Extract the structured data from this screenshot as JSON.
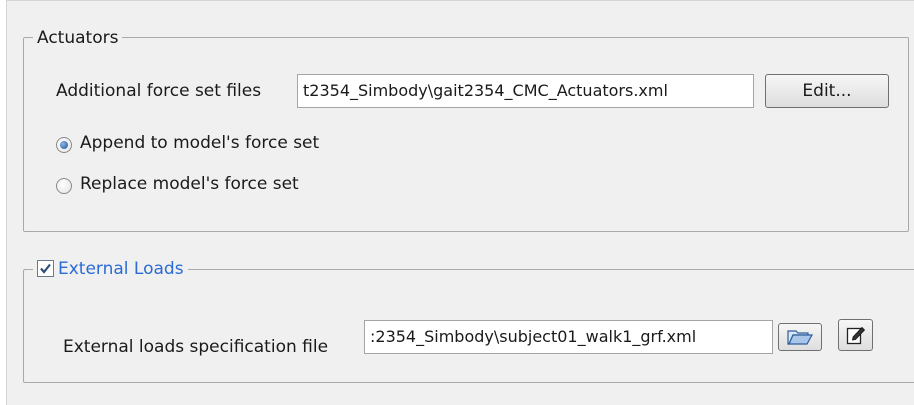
{
  "actuators": {
    "title": "Actuators",
    "force_set_label": "Additional force set files",
    "force_set_value": "t2354_Simbody\\gait2354_CMC_Actuators.xml",
    "edit_button": "Edit...",
    "append_option": "Append to model's force set",
    "replace_option": "Replace model's force set",
    "selected_option": "append"
  },
  "external_loads": {
    "title": "External Loads",
    "enabled": true,
    "spec_label": "External loads specification file",
    "spec_value": ":2354_Simbody\\subject01_walk1_grf.xml",
    "browse_icon": "folder-open-icon",
    "edit_icon": "edit-note-icon"
  },
  "colors": {
    "panel_bg": "#f0f0f0",
    "group_border": "#a9a9a9",
    "link_blue": "#2a6bd4",
    "radio_selected": "#1d4f9a"
  }
}
